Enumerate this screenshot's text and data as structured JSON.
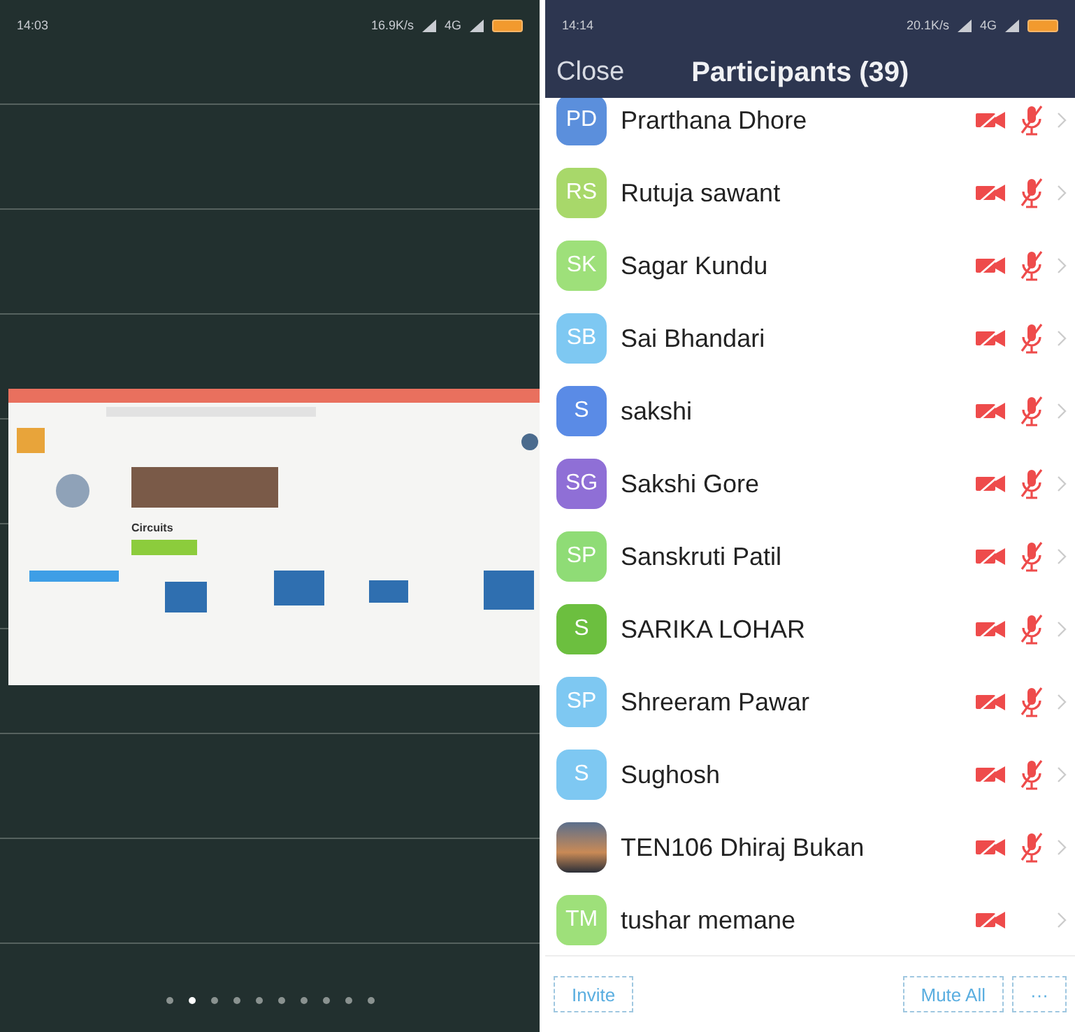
{
  "left_screen": {
    "status_bar": {
      "time": "14:03",
      "speed": "16.9K/s",
      "network": "4G"
    },
    "shared_screen": {
      "heading": "Circuits"
    },
    "page_dots": [
      {
        "selected": false
      },
      {
        "selected": true
      },
      {
        "selected": false
      },
      {
        "selected": false
      },
      {
        "selected": false
      },
      {
        "selected": false
      },
      {
        "selected": false
      },
      {
        "selected": false
      },
      {
        "selected": false
      },
      {
        "selected": false
      }
    ]
  },
  "right_screen": {
    "status_bar": {
      "time": "14:14",
      "speed": "20.1K/s",
      "network": "4G"
    },
    "header": {
      "close": "Close",
      "title": "Participants (39)"
    },
    "participants": [
      {
        "initials": "PD",
        "name": "Prarthana Dhore",
        "color": "#5b8fdc",
        "kind": "initials",
        "video_off": true,
        "audio_muted": true
      },
      {
        "initials": "RS",
        "name": "Rutuja sawant",
        "color": "#a8d86a",
        "kind": "initials",
        "video_off": true,
        "audio_muted": true
      },
      {
        "initials": "SK",
        "name": "Sagar Kundu",
        "color": "#9ee07a",
        "kind": "initials",
        "video_off": true,
        "audio_muted": true
      },
      {
        "initials": "SB",
        "name": "Sai Bhandari",
        "color": "#7ec8f2",
        "kind": "initials",
        "video_off": true,
        "audio_muted": true
      },
      {
        "initials": "S",
        "name": "sakshi",
        "color": "#5a8be6",
        "kind": "initials",
        "video_off": true,
        "audio_muted": true
      },
      {
        "initials": "SG",
        "name": "Sakshi Gore",
        "color": "#8f6fd6",
        "kind": "initials",
        "video_off": true,
        "audio_muted": true
      },
      {
        "initials": "SP",
        "name": "Sanskruti Patil",
        "color": "#8fdc76",
        "kind": "initials",
        "video_off": true,
        "audio_muted": true
      },
      {
        "initials": "S",
        "name": "SARIKA LOHAR",
        "color": "#6cbf3f",
        "kind": "initials",
        "video_off": true,
        "audio_muted": true
      },
      {
        "initials": "SP",
        "name": "Shreeram Pawar",
        "color": "#7ec8f2",
        "kind": "initials",
        "video_off": true,
        "audio_muted": true
      },
      {
        "initials": "S",
        "name": "Sughosh",
        "color": "#7ec8f2",
        "kind": "initials",
        "video_off": true,
        "audio_muted": true
      },
      {
        "name": "TEN106 Dhiraj Bukan",
        "kind": "photo",
        "video_off": true,
        "audio_muted": true
      },
      {
        "initials": "TM",
        "name": "tushar memane",
        "color": "#9ee07a",
        "kind": "initials",
        "video_off": true,
        "audio_muted": false
      }
    ],
    "footer": {
      "invite": "Invite",
      "mute_all": "Mute All",
      "more": "···"
    }
  }
}
